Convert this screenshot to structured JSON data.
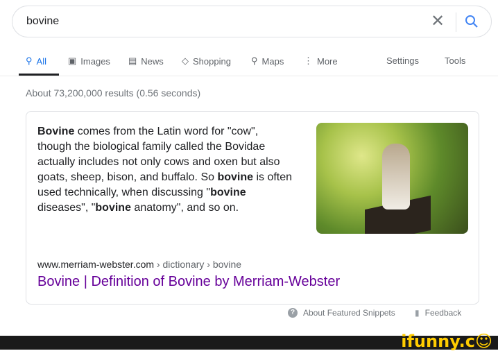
{
  "search": {
    "query": "bovine"
  },
  "tabs": [
    {
      "label": "All",
      "icon": "search-icon"
    },
    {
      "label": "Images",
      "icon": "image-icon"
    },
    {
      "label": "News",
      "icon": "news-icon"
    },
    {
      "label": "Shopping",
      "icon": "tag-icon"
    },
    {
      "label": "Maps",
      "icon": "pin-icon"
    },
    {
      "label": "More",
      "icon": "dots-icon"
    }
  ],
  "tools": {
    "settings": "Settings",
    "tools": "Tools"
  },
  "stats": "About 73,200,000 results (0.56 seconds)",
  "snippet": {
    "parts": [
      [
        "b",
        "Bovine"
      ],
      [
        "t",
        " comes from the Latin word for \"cow\", though the biological family called the Bovidae actually includes not only cows and oxen but also goats, sheep, bison, and buffalo. So "
      ],
      [
        "b",
        "bovine"
      ],
      [
        "t",
        " is often used technically, when discussing \""
      ],
      [
        "b",
        "bovine"
      ],
      [
        "t",
        " diseases\", \""
      ],
      [
        "b",
        "bovine"
      ],
      [
        "t",
        " anatomy\", and so on."
      ]
    ],
    "cite_domain": "www.merriam-webster.com",
    "cite_path": " › dictionary › bovine",
    "title": "Bovine | Definition of Bovine by Merriam-Webster"
  },
  "footer": {
    "about": "About Featured Snippets",
    "feedback": "Feedback"
  },
  "watermark": "ifunny.co",
  "colors": {
    "accent": "#1a73e8",
    "visited_link": "#660099"
  }
}
